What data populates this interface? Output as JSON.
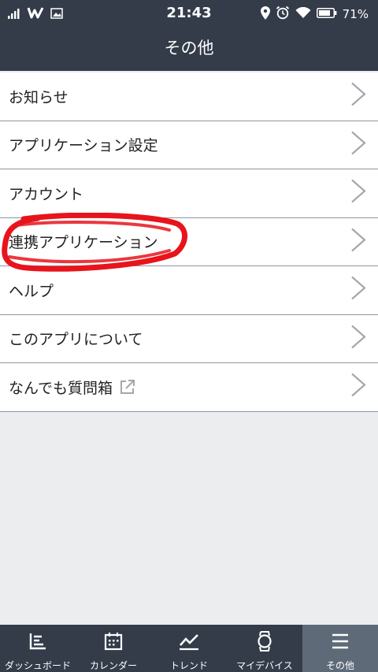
{
  "status": {
    "time": "21:43",
    "battery": "71%",
    "left_icons": [
      "signal-icon",
      "app-w-icon",
      "image-icon"
    ],
    "right_icons": [
      "location-icon",
      "alarm-icon",
      "wifi-icon",
      "battery-icon"
    ]
  },
  "header": {
    "title": "その他"
  },
  "menu": {
    "items": [
      {
        "label": "お知らせ"
      },
      {
        "label": "アプリケーション設定"
      },
      {
        "label": "アカウント"
      },
      {
        "label": "連携アプリケーション"
      },
      {
        "label": "ヘルプ"
      },
      {
        "label": "このアプリについて"
      },
      {
        "label": "なんでも質問箱"
      }
    ]
  },
  "tabs": [
    {
      "label": "ダッシュボード",
      "icon": "dashboard-icon"
    },
    {
      "label": "カレンダー",
      "icon": "calendar-icon"
    },
    {
      "label": "トレンド",
      "icon": "trend-icon"
    },
    {
      "label": "マイデバイス",
      "icon": "watch-icon"
    },
    {
      "label": "その他",
      "icon": "menu-icon",
      "active": true
    }
  ],
  "colors": {
    "bar": "#343c4a",
    "active_tab": "#5e6a78",
    "annotation": "#e8141c",
    "divider": "#8d96a1"
  }
}
